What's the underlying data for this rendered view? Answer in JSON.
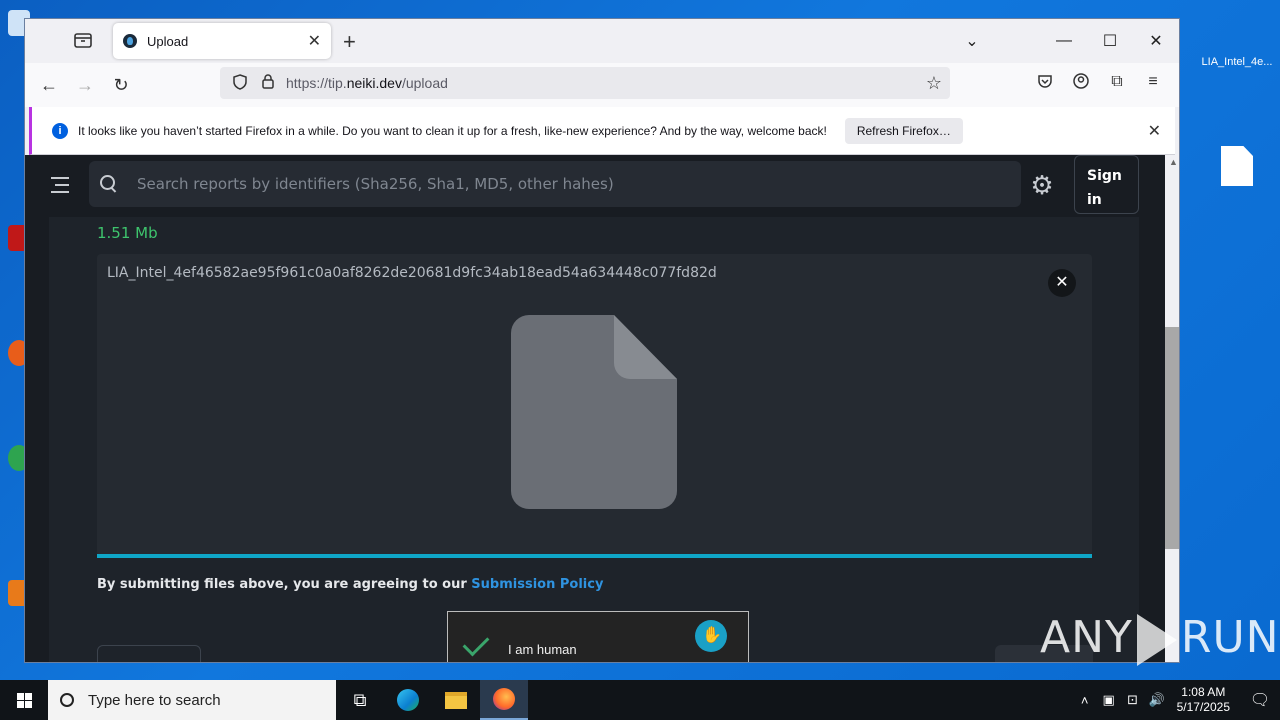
{
  "desktop": {
    "file_icon_label": "LIA_Intel_4e..."
  },
  "browser": {
    "tab_title": "Upload",
    "url_prefix": "https://tip.",
    "url_domain": "neiki.dev",
    "url_path": "/upload",
    "notification": {
      "message": "It looks like you haven’t started Firefox in a while. Do you want to clean it up for a fresh, like-new experience? And by the way, welcome back!",
      "button": "Refresh Firefox…"
    }
  },
  "app": {
    "search_placeholder": "Search reports by identifiers (Sha256, Sha1, MD5, other hahes)",
    "sign_in": "Sign in",
    "file_size": "1.51 Mb",
    "file_name": "LIA_Intel_4ef46582ae95f961c0a0af8262de20681d9fc34ab18ead54a634448c077fd82d",
    "upload_progress": 1.0,
    "policy_text": "By submitting files above, you are agreeing to our ",
    "policy_link": "Submission Policy",
    "captcha_label": "I am human"
  },
  "watermark": {
    "left": "ANY",
    "right": "RUN"
  },
  "taskbar": {
    "search_placeholder": "Type here to search",
    "time": "1:08 AM",
    "date": "5/17/2025"
  },
  "colors": {
    "accent_progress": "#0fa6c7",
    "file_size_green": "#3ec46d",
    "link_blue": "#2f93e0"
  }
}
